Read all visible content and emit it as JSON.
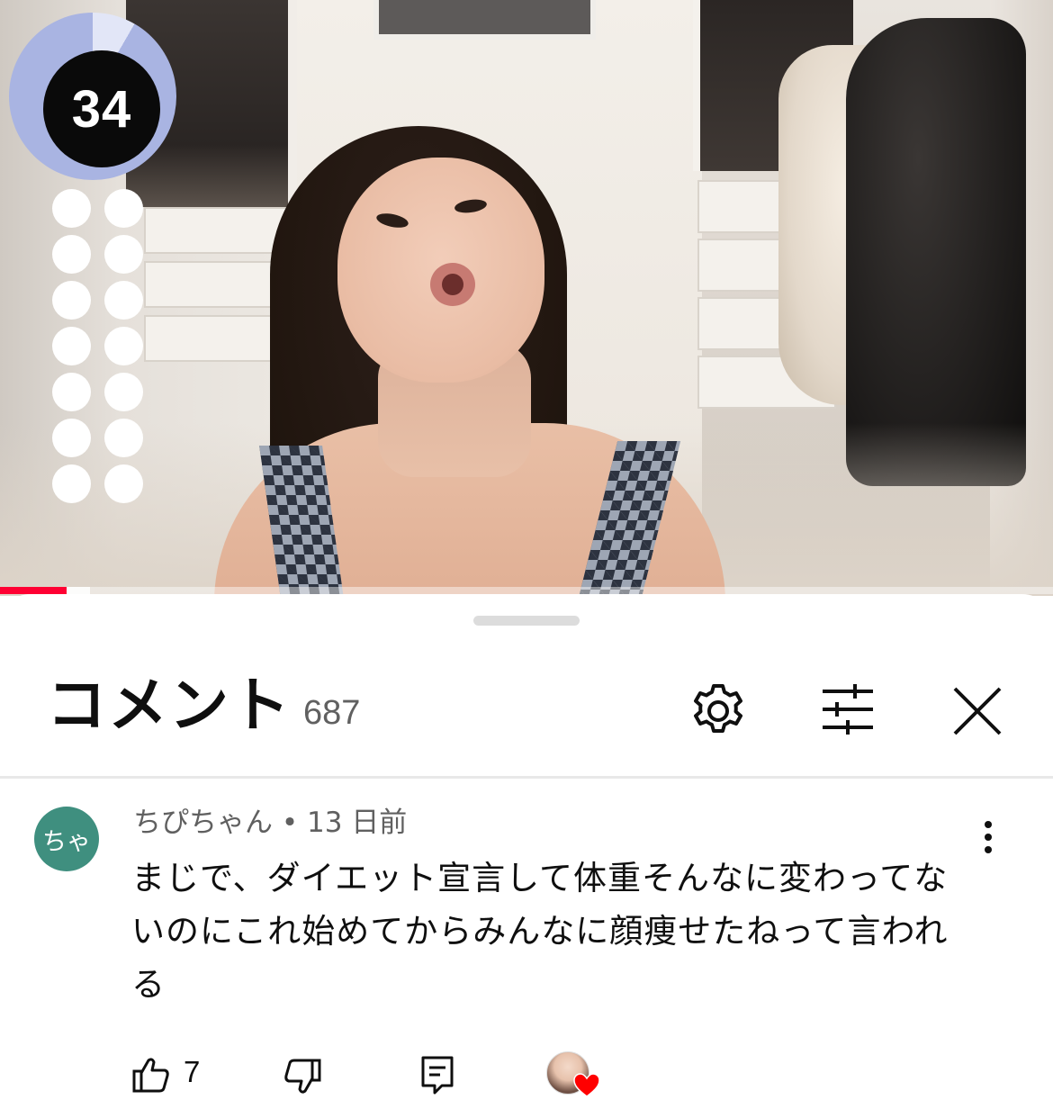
{
  "player": {
    "counter_value": "34",
    "progress_fraction": 0.063,
    "accent_color": "#ff0033"
  },
  "comments_panel": {
    "title": "コメント",
    "count": "687",
    "icons": [
      "settings-gear-icon",
      "filter-sliders-icon",
      "close-icon"
    ]
  },
  "comment": {
    "avatar_text": "ちゃ",
    "avatar_color": "#3f8f7f",
    "author": "ちぴちゃん",
    "time": "13 日前",
    "text": "まじで、ダイエット宣言して体重そんなに変わってないのにこれ始めてからみんなに顔痩せたねって言われる",
    "like_count": "7",
    "icons": [
      "more-vert-icon",
      "thumb-up-icon",
      "thumb-down-icon",
      "reply-icon",
      "creator-heart-icon"
    ]
  }
}
